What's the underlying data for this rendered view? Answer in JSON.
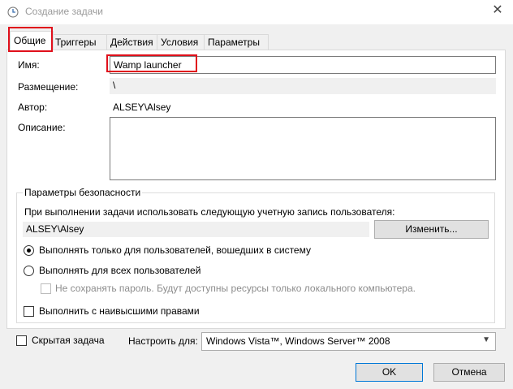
{
  "window": {
    "title": "Создание задачи",
    "icon": "task-scheduler-icon",
    "close_glyph": "✕"
  },
  "tabs": [
    {
      "label": "Общие",
      "active": true
    },
    {
      "label": "Триггеры",
      "active": false
    },
    {
      "label": "Действия",
      "active": false
    },
    {
      "label": "Условия",
      "active": false
    },
    {
      "label": "Параметры",
      "active": false
    }
  ],
  "general": {
    "name_label": "Имя:",
    "name_value": "Wamp launcher",
    "location_label": "Размещение:",
    "location_value": "\\",
    "author_label": "Автор:",
    "author_value": "ALSEY\\Alsey",
    "description_label": "Описание:",
    "description_value": ""
  },
  "security": {
    "group_title": "Параметры безопасности",
    "run_as_text": "При выполнении задачи использовать следующую учетную запись пользователя:",
    "user_account": "ALSEY\\Alsey",
    "change_button": "Изменить...",
    "radio_logged_on": {
      "label": "Выполнять только для пользователей, вошедших в систему",
      "selected": true
    },
    "radio_all_users": {
      "label": "Выполнять для всех пользователей",
      "selected": false
    },
    "no_store_password": {
      "label": "Не сохранять пароль. Будут доступны ресурсы только локального компьютера.",
      "checked": false,
      "enabled": false
    },
    "highest_privileges": {
      "label": "Выполнить с наивысшими правами",
      "checked": false
    }
  },
  "footer": {
    "hidden_label": "Скрытая задача",
    "hidden_checked": false,
    "configure_label": "Настроить для:",
    "configure_value": "Windows Vista™, Windows Server™ 2008",
    "ok_button": "OK",
    "cancel_button": "Отмена"
  },
  "colors": {
    "highlight": "#e0101b",
    "panel_bg": "#ffffff",
    "dialog_bg": "#f0f0f0",
    "ok_border": "#0078d7"
  }
}
